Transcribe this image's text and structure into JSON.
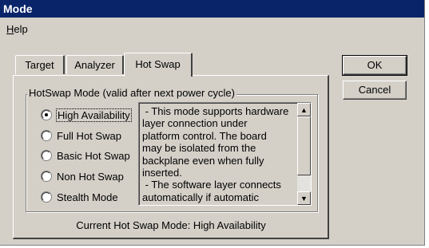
{
  "window": {
    "title": "Mode"
  },
  "menu": {
    "help_first": "H",
    "help_rest": "elp"
  },
  "tabs": [
    {
      "label": "Target"
    },
    {
      "label": "Analyzer"
    },
    {
      "label": "Hot Swap",
      "selected": true
    }
  ],
  "group": {
    "label": "HotSwap Mode (valid after next power cycle)",
    "options": [
      {
        "label": "High Availability",
        "checked": true
      },
      {
        "label": "Full Hot Swap",
        "checked": false
      },
      {
        "label": "Basic Hot Swap",
        "checked": false
      },
      {
        "label": "Non Hot Swap",
        "checked": false
      },
      {
        "label": "Stealth Mode",
        "checked": false
      }
    ],
    "description": " - This mode supports hardware\nlayer connection under\nplatform control. The board\nmay be isolated from the\nbackplane even when fully\ninserted.\n - The software layer connects\nautomatically if automatic"
  },
  "status": {
    "current_mode": "Current Hot Swap Mode: High Availability"
  },
  "buttons": {
    "ok": "OK",
    "cancel": "Cancel"
  },
  "colors": {
    "titlebar": "#0a246a",
    "face": "#d4d0c8"
  }
}
